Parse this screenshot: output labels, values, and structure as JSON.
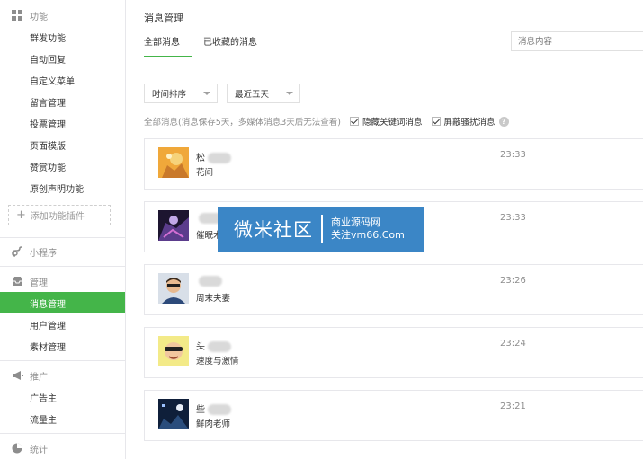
{
  "sidebar": {
    "functions_header": "功能",
    "function_items": [
      "群发功能",
      "自动回复",
      "自定义菜单",
      "留言管理",
      "投票管理",
      "页面模版",
      "赞赏功能",
      "原创声明功能"
    ],
    "add_plugin": "添加功能插件",
    "miniprogram_header": "小程序",
    "manage_header": "管理",
    "manage_items": [
      "消息管理",
      "用户管理",
      "素材管理"
    ],
    "promote_header": "推广",
    "promote_items": [
      "广告主",
      "流量主"
    ],
    "stats_header": "统计"
  },
  "main": {
    "page_title": "消息管理",
    "tabs": [
      "全部消息",
      "已收藏的消息"
    ],
    "search_placeholder": "消息内容",
    "sort_select": "时间排序",
    "range_select": "最近五天",
    "filter_hint": "全部消息(消息保存5天，多媒体消息3天后无法查看)",
    "hide_keyword": "隐藏关键词消息",
    "block_harass": "屏蔽骚扰消息",
    "help_mark": "?",
    "messages": [
      {
        "name": "松",
        "content": "花间",
        "time": "23:33"
      },
      {
        "name": "",
        "content": "催眠术",
        "time": "23:33"
      },
      {
        "name": "",
        "content": "周末夫妻",
        "time": "23:26"
      },
      {
        "name": "头",
        "content": "速度与激情",
        "time": "23:24"
      },
      {
        "name": "些",
        "content": "鲜肉老师",
        "time": "23:21"
      }
    ]
  },
  "watermark": {
    "big": "微米社区",
    "line1": "商业源码网",
    "line2": "关注vm66.Com"
  }
}
